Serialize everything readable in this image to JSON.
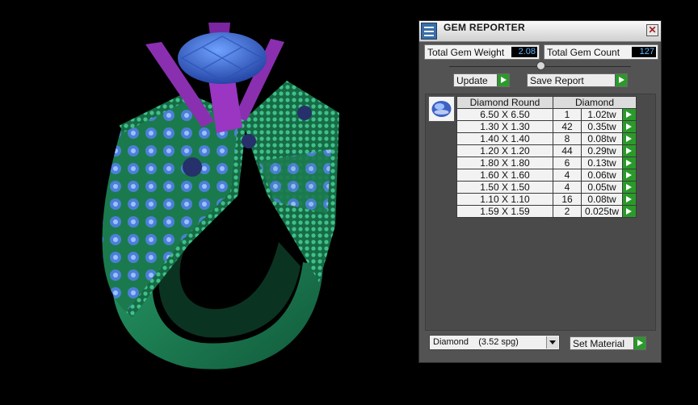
{
  "panel": {
    "title": "GEM REPORTER",
    "close_glyph": "✕",
    "total_weight_label": "Total Gem Weight",
    "total_weight_value": "2.08",
    "total_count_label": "Total Gem Count",
    "total_count_value": "127",
    "update_label": "Update",
    "save_label": "Save Report",
    "table": {
      "headers": [
        "Diamond Round",
        "Diamond"
      ],
      "rows": [
        {
          "size": "6.50 X 6.50",
          "count": "1",
          "weight": "1.02tw"
        },
        {
          "size": "1.30 X 1.30",
          "count": "42",
          "weight": "0.35tw"
        },
        {
          "size": "1.40 X 1.40",
          "count": "8",
          "weight": "0.08tw"
        },
        {
          "size": "1.20 X 1.20",
          "count": "44",
          "weight": "0.29tw"
        },
        {
          "size": "1.80 X 1.80",
          "count": "6",
          "weight": "0.13tw"
        },
        {
          "size": "1.60 X 1.60",
          "count": "4",
          "weight": "0.06tw"
        },
        {
          "size": "1.50 X 1.50",
          "count": "4",
          "weight": "0.05tw"
        },
        {
          "size": "1.10 X 1.10",
          "count": "16",
          "weight": "0.08tw"
        },
        {
          "size": "1.59 X 1.59",
          "count": "2",
          "weight": "0.025tw"
        }
      ]
    },
    "material_select": "Diamond    (3.52 spg)",
    "set_material_label": "Set Material"
  },
  "colors": {
    "ring_metal": "#1f8a5a",
    "prong": "#8a2fb0",
    "center_stone": "#3a6fd6",
    "accent_green": "#2a9a2a"
  },
  "icons": [
    "gem-reporter-app-icon",
    "close-icon",
    "play-arrow-icon",
    "dropdown-arrow-icon",
    "gem-thumbnail-icon"
  ]
}
